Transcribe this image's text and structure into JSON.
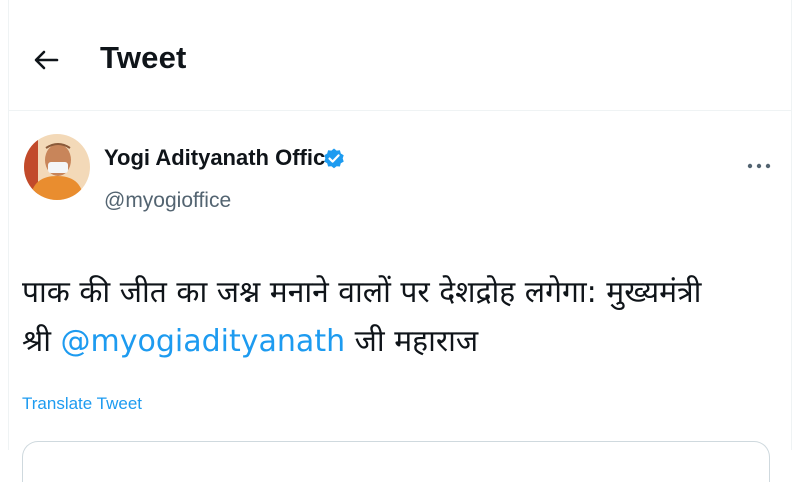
{
  "header": {
    "title": "Tweet",
    "back_icon": "arrow-left-icon"
  },
  "tweet": {
    "author": {
      "display_name": "Yogi Adityanath Office",
      "handle": "@myogioffice",
      "verified": true,
      "verified_badge_color": "#1d9bf0"
    },
    "text_line1": "पाक की जीत का जश्न मनाने वालों पर देशद्रोह लगेगा: मुख्यमंत्री",
    "text_line2_prefix": "श्री ",
    "mention": "@myogiadityanath",
    "text_line2_suffix": " जी महाराज",
    "translate_label": "Translate Tweet",
    "more_icon": "more-horizontal-icon"
  },
  "colors": {
    "accent": "#1d9bf0",
    "text": "#0f1419",
    "secondary_text": "#536471",
    "divider": "#eff3f4"
  }
}
